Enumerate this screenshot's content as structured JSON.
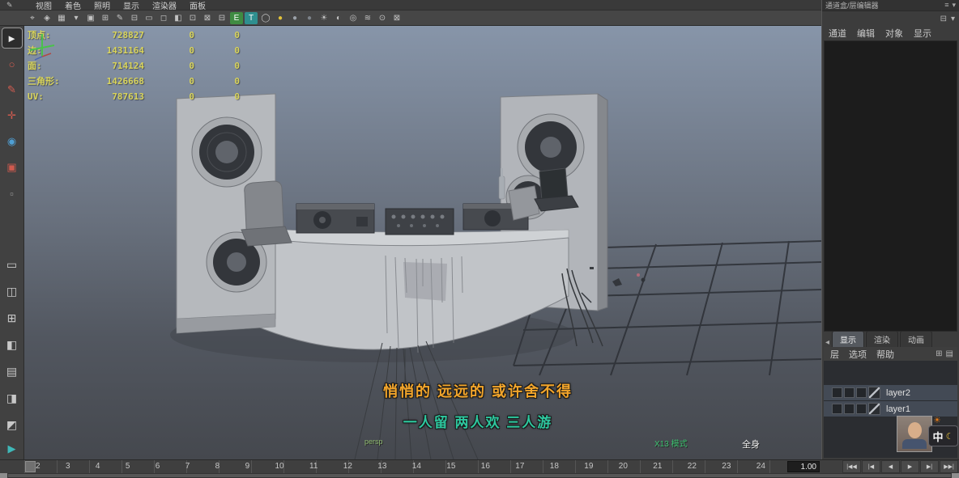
{
  "panel_menubar": {
    "icon": {
      "name": "pencil-icon",
      "g": "✎"
    },
    "items": [
      {
        "label": "视图"
      },
      {
        "label": "着色"
      },
      {
        "label": "照明"
      },
      {
        "label": "显示"
      },
      {
        "label": "渲染器"
      },
      {
        "label": "面板"
      }
    ]
  },
  "viewport_toolbar": {
    "icons": [
      {
        "name": "select-camera-icon",
        "g": "⌖",
        "c": "#c2c2c2"
      },
      {
        "name": "lock-camera-icon",
        "g": "◈",
        "c": "#c2c2c2"
      },
      {
        "name": "camera-attributes-icon",
        "g": "▦",
        "c": "#c2c2c2"
      },
      {
        "name": "bookmark-icon",
        "g": "▾",
        "c": "#c2c2c2"
      },
      {
        "name": "image-plane-icon",
        "g": "▣",
        "c": "#c2c2c2"
      },
      {
        "name": "two-d-pan-zoom-icon",
        "g": "⊞",
        "c": "#c2c2c2"
      },
      {
        "name": "grease-pencil-icon",
        "g": "✎",
        "c": "#c2c2c2"
      },
      {
        "name": "grid-icon",
        "g": "⊟",
        "c": "#c2c2c2"
      },
      {
        "name": "film-gate-icon",
        "g": "▭",
        "c": "#c2c2c2"
      },
      {
        "name": "resolution-gate-icon",
        "g": "◻",
        "c": "#c2c2c2"
      },
      {
        "name": "gate-mask-icon",
        "g": "◧",
        "c": "#c2c2c2"
      },
      {
        "name": "field-chart-icon",
        "g": "⊡",
        "c": "#c2c2c2"
      },
      {
        "name": "safe-action-icon",
        "g": "⊠",
        "c": "#c2c2c2"
      },
      {
        "name": "safe-title-icon",
        "g": "⊟",
        "c": "#c2c2c2"
      },
      {
        "name": "fill-mode-icon",
        "g": "E",
        "c": "#ffffff",
        "bg": "#3f8c42"
      },
      {
        "name": "textured-mode-icon",
        "g": "T",
        "c": "#ffffff",
        "bg": "#2f8f8f"
      },
      {
        "name": "wireframe-icon",
        "g": "◯",
        "c": "#c2c2c2"
      },
      {
        "name": "default-material-icon",
        "g": "●",
        "c": "#e2c23a"
      },
      {
        "name": "shaded-sphere-icon",
        "g": "●",
        "c": "#9aa0a8"
      },
      {
        "name": "textured-sphere-icon",
        "g": "●",
        "c": "#7c828a"
      },
      {
        "name": "lighting-icon",
        "g": "☀",
        "c": "#c2c2c2"
      },
      {
        "name": "shadows-icon",
        "g": "◐",
        "c": "#c2c2c2"
      },
      {
        "name": "screen-ao-icon",
        "g": "◎",
        "c": "#c2c2c2"
      },
      {
        "name": "motion-blur-icon",
        "g": "≋",
        "c": "#c2c2c2"
      },
      {
        "name": "isolate-select-icon",
        "g": "⊙",
        "c": "#c2c2c2"
      },
      {
        "name": "xray-icon",
        "g": "⊠",
        "c": "#c2c2c2"
      }
    ]
  },
  "toolbox": {
    "tools": [
      {
        "name": "select-tool-icon",
        "g": "►",
        "c": "#ececec",
        "selected": true
      },
      {
        "name": "lasso-tool-icon",
        "g": "○",
        "c": "#d25c50"
      },
      {
        "name": "paint-select-tool-icon",
        "g": "✎",
        "c": "#d25c50"
      },
      {
        "name": "move-tool-icon",
        "g": "✛",
        "c": "#cf5a4e"
      },
      {
        "name": "rotate-tool-icon",
        "g": "◉",
        "c": "#4f9fd4"
      },
      {
        "name": "scale-tool-icon",
        "g": "▣",
        "c": "#cf5a4e"
      },
      {
        "name": "last-tool-icon",
        "g": "▫",
        "c": "#9a9a9a"
      }
    ],
    "layouts": [
      {
        "name": "layout-single-pane-icon",
        "g": "▭"
      },
      {
        "name": "layout-two-pane-icon",
        "g": "◫"
      },
      {
        "name": "layout-four-pane-icon",
        "g": "⊞"
      },
      {
        "name": "layout-persp-outliner-icon",
        "g": "◧"
      },
      {
        "name": "layout-horizontal-split-icon",
        "g": "▤"
      },
      {
        "name": "layout-persp-graph-icon",
        "g": "◨"
      },
      {
        "name": "layout-custom-icon",
        "g": "◩"
      }
    ],
    "extra": {
      "name": "hypershade-icon",
      "g": "▶",
      "c": "#3fb8b8"
    }
  },
  "hud": {
    "rows": [
      {
        "label": "顶点:",
        "value": "728827",
        "col2": "0",
        "col3": "0"
      },
      {
        "label": "边:",
        "value": "1431164",
        "col2": "0",
        "col3": "0"
      },
      {
        "label": "面:",
        "value": "714124",
        "col2": "0",
        "col3": "0"
      },
      {
        "label": "三角形:",
        "value": "1426668",
        "col2": "0",
        "col3": "0"
      },
      {
        "label": "UV:",
        "value": "787613",
        "col2": "0",
        "col3": "0"
      }
    ]
  },
  "viewport": {
    "subtitle_line1": "悄悄的  远远的  或许舍不得",
    "subtitle_line2": "一人留  两人欢  三人游",
    "camera_label": "persp",
    "footer_green": "X13 模式",
    "footer_white": "全身"
  },
  "channel_box": {
    "title": "通道盒/层编辑器",
    "title_icons": [
      {
        "name": "panel-menu-icon",
        "g": "≡"
      },
      {
        "name": "panel-collapse-icon",
        "g": "▾"
      }
    ],
    "sub_icons": [
      {
        "name": "channel-sliders-icon",
        "g": "⊟"
      },
      {
        "name": "channel-settings-icon",
        "g": "▾"
      }
    ],
    "menus": [
      {
        "label": "通道"
      },
      {
        "label": "编辑"
      },
      {
        "label": "对象"
      },
      {
        "label": "显示"
      }
    ]
  },
  "layer_editor": {
    "collapse_icon": {
      "name": "collapse-arrow-icon",
      "g": "◂"
    },
    "tabs": [
      {
        "label": "显示",
        "active": true
      },
      {
        "label": "渲染"
      },
      {
        "label": "动画"
      }
    ],
    "menus": [
      {
        "label": "层"
      },
      {
        "label": "选项"
      },
      {
        "label": "帮助"
      }
    ],
    "menu_icons": [
      {
        "name": "new-empty-layer-icon",
        "g": "⊞"
      },
      {
        "name": "new-layer-from-selected-icon",
        "g": "▤"
      }
    ],
    "layers": [
      {
        "name": "layer2"
      },
      {
        "name": "layer1"
      }
    ]
  },
  "overlays": {
    "sun_icon": "☀",
    "ime_text": "中",
    "moon_icon": "☾"
  },
  "timeline": {
    "frames": [
      "2",
      "3",
      "4",
      "5",
      "6",
      "7",
      "8",
      "9",
      "10",
      "11",
      "12",
      "13",
      "14",
      "15",
      "16",
      "17",
      "18",
      "19",
      "20",
      "21",
      "22",
      "23",
      "24"
    ],
    "current_time": "1.00",
    "playback": [
      {
        "name": "go-to-start-button",
        "g": "|◀◀"
      },
      {
        "name": "step-back-frame-button",
        "g": "|◀"
      },
      {
        "name": "play-backwards-button",
        "g": "◀"
      },
      {
        "name": "play-forwards-button",
        "g": "▶"
      },
      {
        "name": "step-forward-frame-button",
        "g": "▶|"
      },
      {
        "name": "go-to-end-button",
        "g": "▶▶|"
      }
    ]
  }
}
